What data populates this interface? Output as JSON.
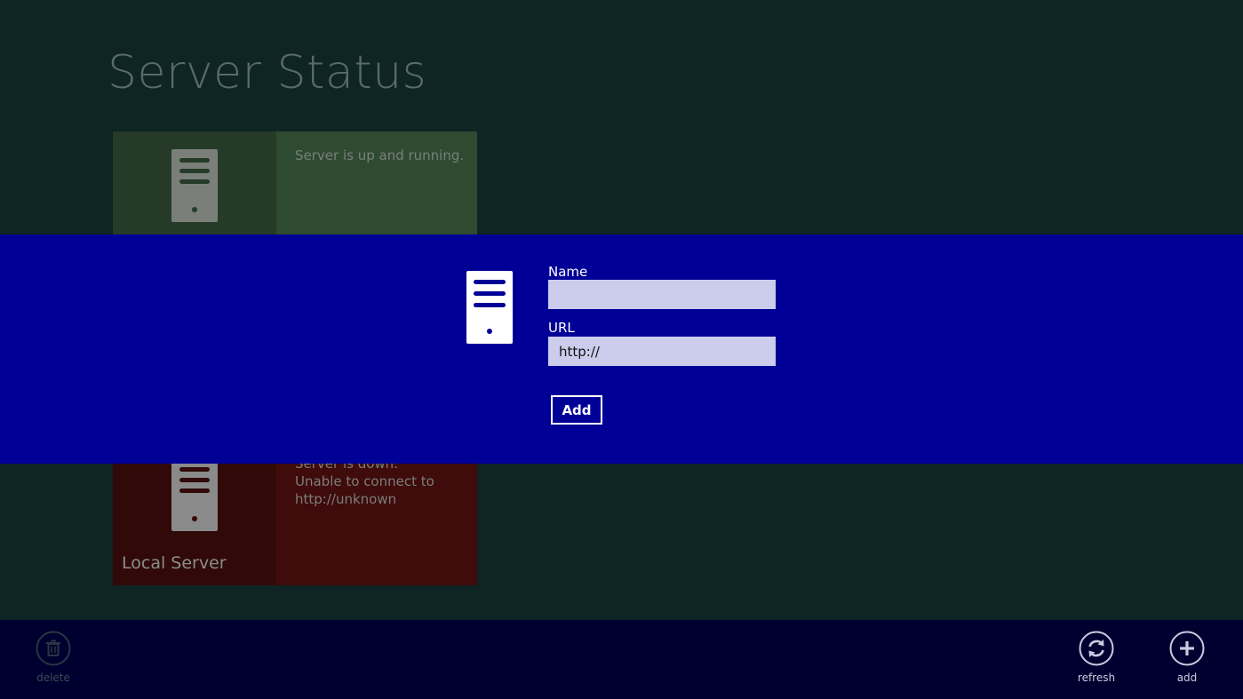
{
  "page": {
    "title": "Server Status"
  },
  "tiles": [
    {
      "status": "up",
      "message": "Server is up and running.",
      "label": "",
      "icon": "server-icon",
      "color": "#2e4b32"
    },
    {
      "status": "down",
      "message_line1": "Server is down.",
      "message_line2": "Unable to connect to",
      "message_line3": "http://unknown",
      "label": "Local Server",
      "icon": "server-icon",
      "color": "#3f0b0b"
    }
  ],
  "dialog": {
    "icon": "server-icon",
    "name_label": "Name",
    "name_value": "",
    "url_label": "URL",
    "url_value": "http://",
    "add_label": "Add",
    "background": "#000096"
  },
  "app_bar": {
    "delete_label": "delete",
    "refresh_label": "refresh",
    "add_label": "add"
  },
  "colors": {
    "overlay_dialog": "#000096",
    "app_bar": "#000030",
    "input_bg": "#ccccec"
  }
}
